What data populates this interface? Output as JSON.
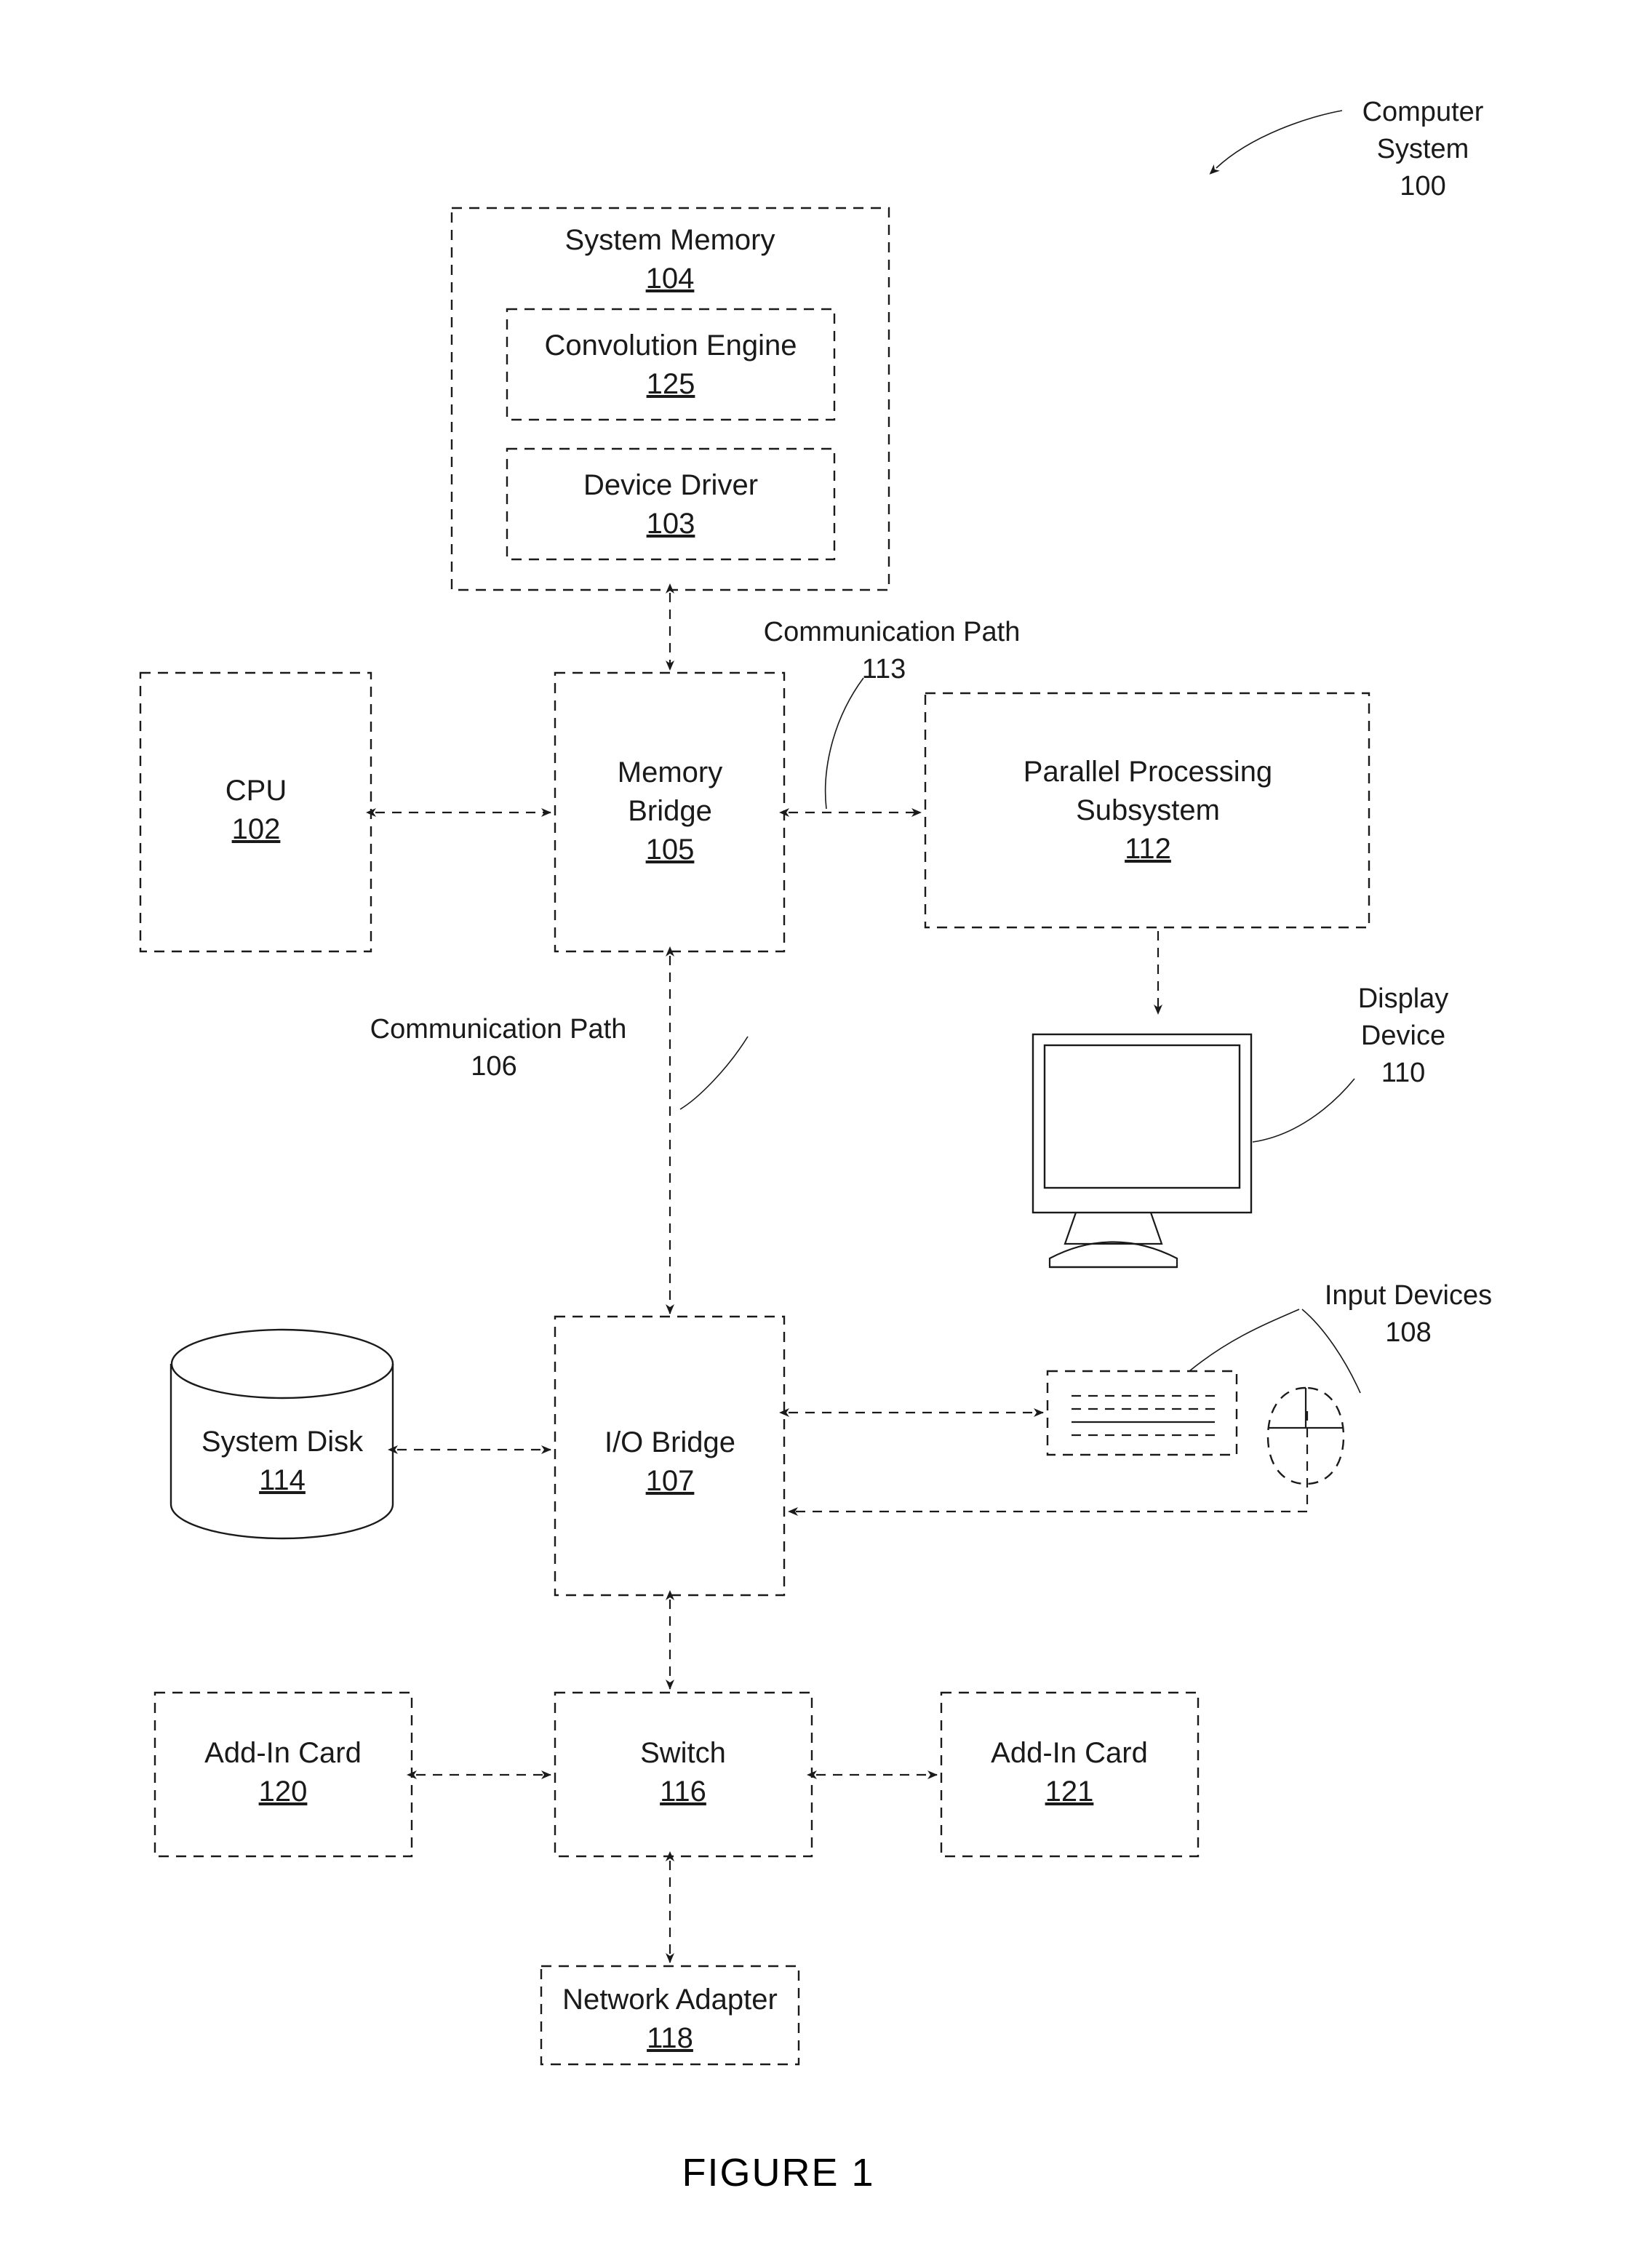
{
  "figure": {
    "caption": "FIGURE 1"
  },
  "callouts": {
    "computer_system": {
      "line1": "Computer",
      "line2": "System",
      "number": "100"
    },
    "comm_path_113": {
      "line1": "Communication Path",
      "number": "113"
    },
    "comm_path_106": {
      "line1": "Communication Path",
      "number": "106"
    },
    "display_device": {
      "line1": "Display",
      "line2": "Device",
      "number": "110"
    },
    "input_devices": {
      "line1": "Input Devices",
      "number": "108"
    }
  },
  "blocks": {
    "system_memory": {
      "label": "System Memory",
      "number": "104"
    },
    "convolution_engine": {
      "label": "Convolution Engine",
      "number": "125"
    },
    "device_driver": {
      "label": "Device Driver",
      "number": "103"
    },
    "cpu": {
      "label": "CPU",
      "number": "102"
    },
    "memory_bridge": {
      "label_line1": "Memory",
      "label_line2": "Bridge",
      "number": "105"
    },
    "parallel_processing_subsystem": {
      "label_line1": "Parallel Processing",
      "label_line2": "Subsystem",
      "number": "112"
    },
    "system_disk": {
      "label": "System Disk",
      "number": "114"
    },
    "io_bridge": {
      "label": "I/O Bridge",
      "number": "107"
    },
    "add_in_card_left": {
      "label": "Add-In Card",
      "number": "120"
    },
    "switch": {
      "label": "Switch",
      "number": "116"
    },
    "add_in_card_right": {
      "label": "Add-In Card",
      "number": "121"
    },
    "network_adapter": {
      "label": "Network Adapter",
      "number": "118"
    }
  },
  "icons": {
    "display": "monitor-icon",
    "keyboard": "keyboard-icon",
    "mouse": "mouse-icon",
    "disk": "cylinder-disk-icon"
  },
  "colors": {
    "stroke": "#1a1a1a",
    "background": "#ffffff"
  }
}
